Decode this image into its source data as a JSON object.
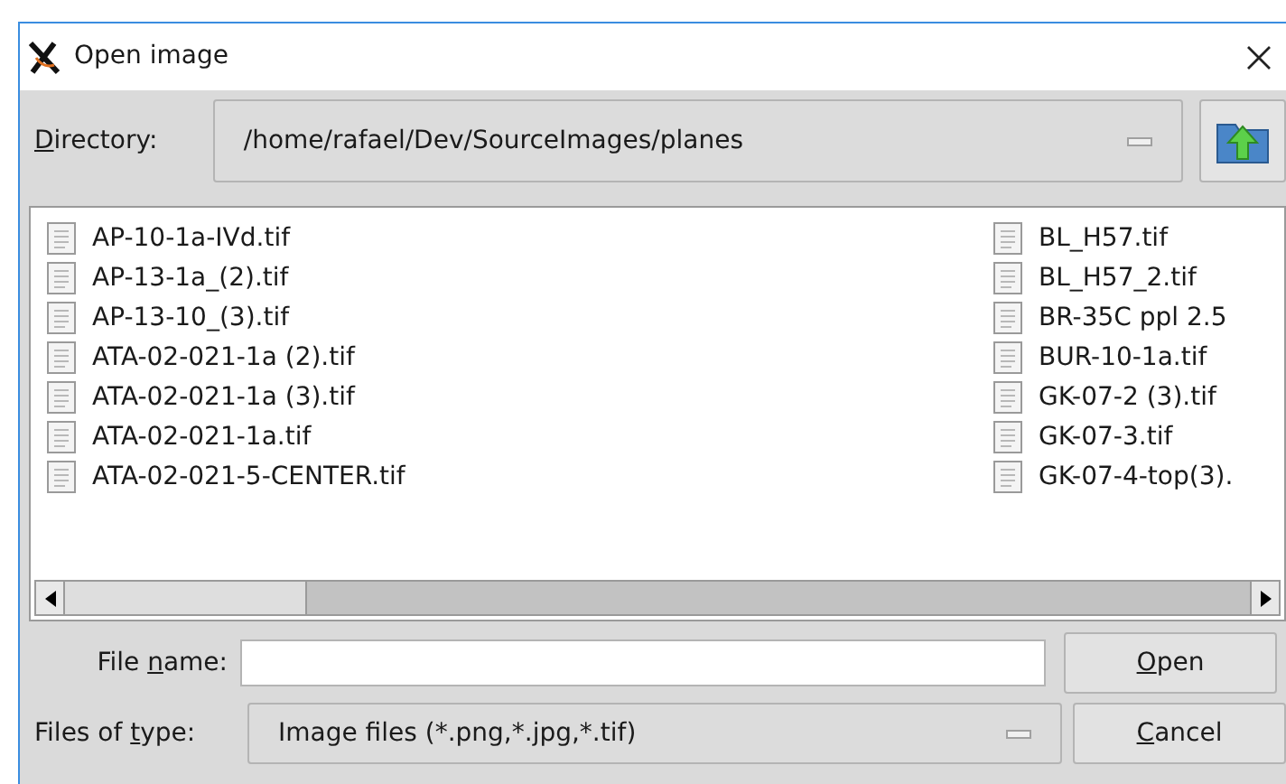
{
  "window": {
    "title": "Open image"
  },
  "directory": {
    "label": {
      "key": "D",
      "post": "irectory:"
    },
    "value": "/home/rafael/Dev/SourceImages/planes"
  },
  "files": {
    "columns": [
      [
        "AP-10-1a-IVd.tif",
        "AP-13-1a_(2).tif",
        "AP-13-10_(3).tif",
        "ATA-02-021-1a (2).tif",
        "ATA-02-021-1a (3).tif",
        "ATA-02-021-1a.tif",
        "ATA-02-021-5-CENTER.tif"
      ],
      [
        "BL_H57.tif",
        "BL_H57_2.tif",
        "BR-35C ppl 2.5",
        "BUR-10-1a.tif",
        "GK-07-2 (3).tif",
        "GK-07-3.tif",
        "GK-07-4-top(3)."
      ]
    ]
  },
  "file_name": {
    "label": {
      "pre": "File ",
      "key": "n",
      "post": "ame:"
    }
  },
  "file_type": {
    "label": {
      "pre": "Files of ",
      "key": "t",
      "post": "ype:"
    },
    "value": "Image files (*.png,*.jpg,*.tif)"
  },
  "buttons": [
    {
      "key": "O",
      "post": "pen"
    },
    {
      "key": "C",
      "post": "ancel"
    }
  ]
}
